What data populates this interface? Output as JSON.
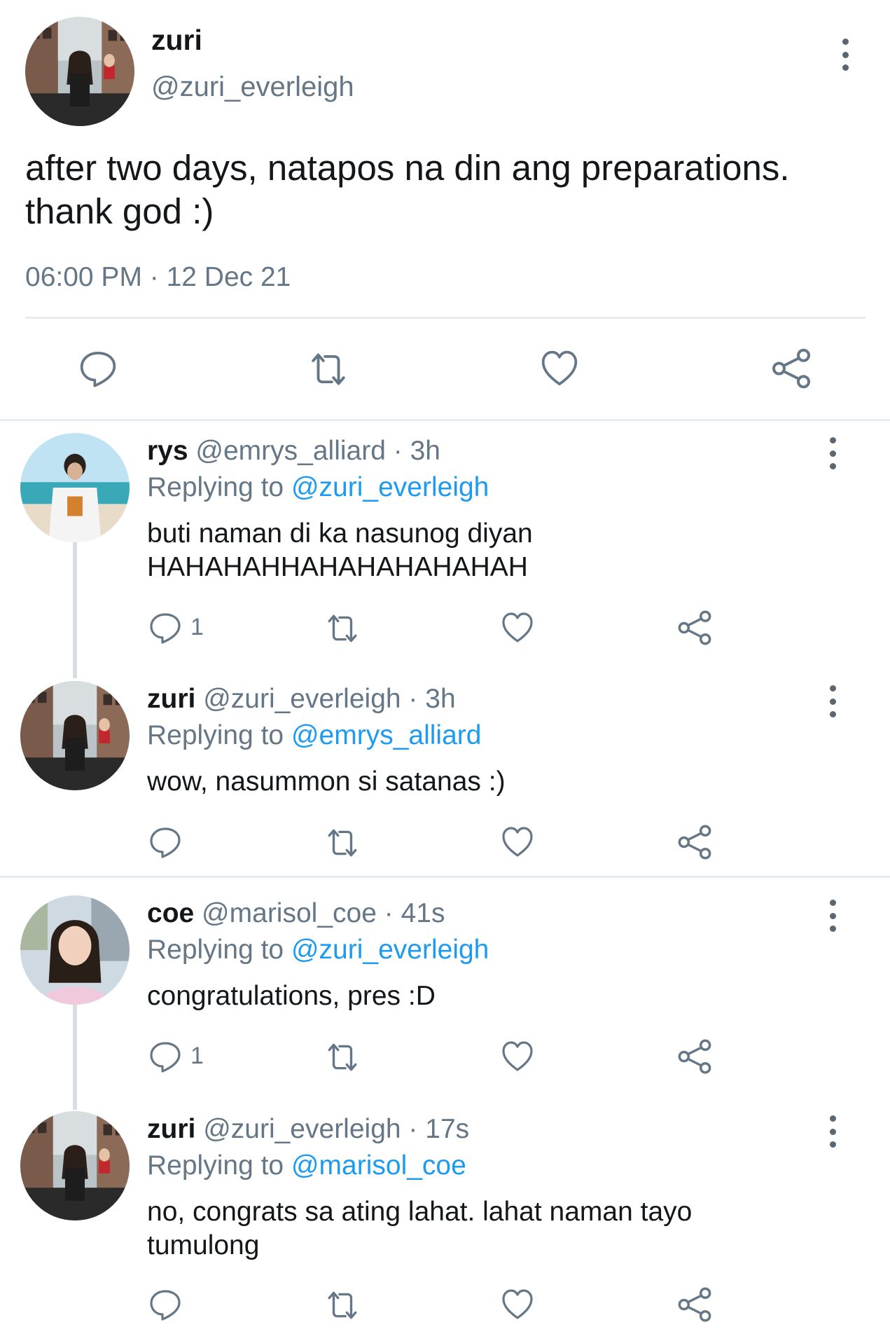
{
  "colors": {
    "accent": "#1d9bf0",
    "muted": "#657786",
    "divider": "#e6ecf0"
  },
  "main_tweet": {
    "display_name": "zuri",
    "handle": "@zuri_everleigh",
    "text_line1": "after two days, natapos na din ang preparations.",
    "text_line2": "thank god :)",
    "timestamp": "06:00 PM · 12 Dec 21"
  },
  "replies": [
    {
      "display_name": "rys",
      "handle": "@emrys_alliard",
      "time": "3h",
      "sep": "·",
      "replying_label": "Replying to",
      "replying_to": "@zuri_everleigh",
      "text_line1": "buti naman di ka nasunog diyan",
      "text_line2": "HAHAHAHHAHAHAHAHAHAH",
      "reply_count": "1"
    },
    {
      "display_name": "zuri",
      "handle": "@zuri_everleigh",
      "time": "3h",
      "sep": "·",
      "replying_label": "Replying to",
      "replying_to": "@emrys_alliard",
      "text_line1": "wow, nasummon si satanas :)",
      "reply_count": ""
    },
    {
      "display_name": "coe",
      "handle": "@marisol_coe",
      "time": "41s",
      "sep": "·",
      "replying_label": "Replying to",
      "replying_to": "@zuri_everleigh",
      "text_line1": "congratulations, pres :D",
      "reply_count": "1"
    },
    {
      "display_name": "zuri",
      "handle": "@zuri_everleigh",
      "time": "17s",
      "sep": "·",
      "replying_label": "Replying to",
      "replying_to": "@marisol_coe",
      "text_line1": "no, congrats sa ating lahat. lahat naman tayo",
      "text_line2": "tumulong",
      "reply_count": ""
    }
  ],
  "icons": [
    "reply-icon",
    "retweet-icon",
    "like-icon",
    "share-icon",
    "more-icon"
  ]
}
